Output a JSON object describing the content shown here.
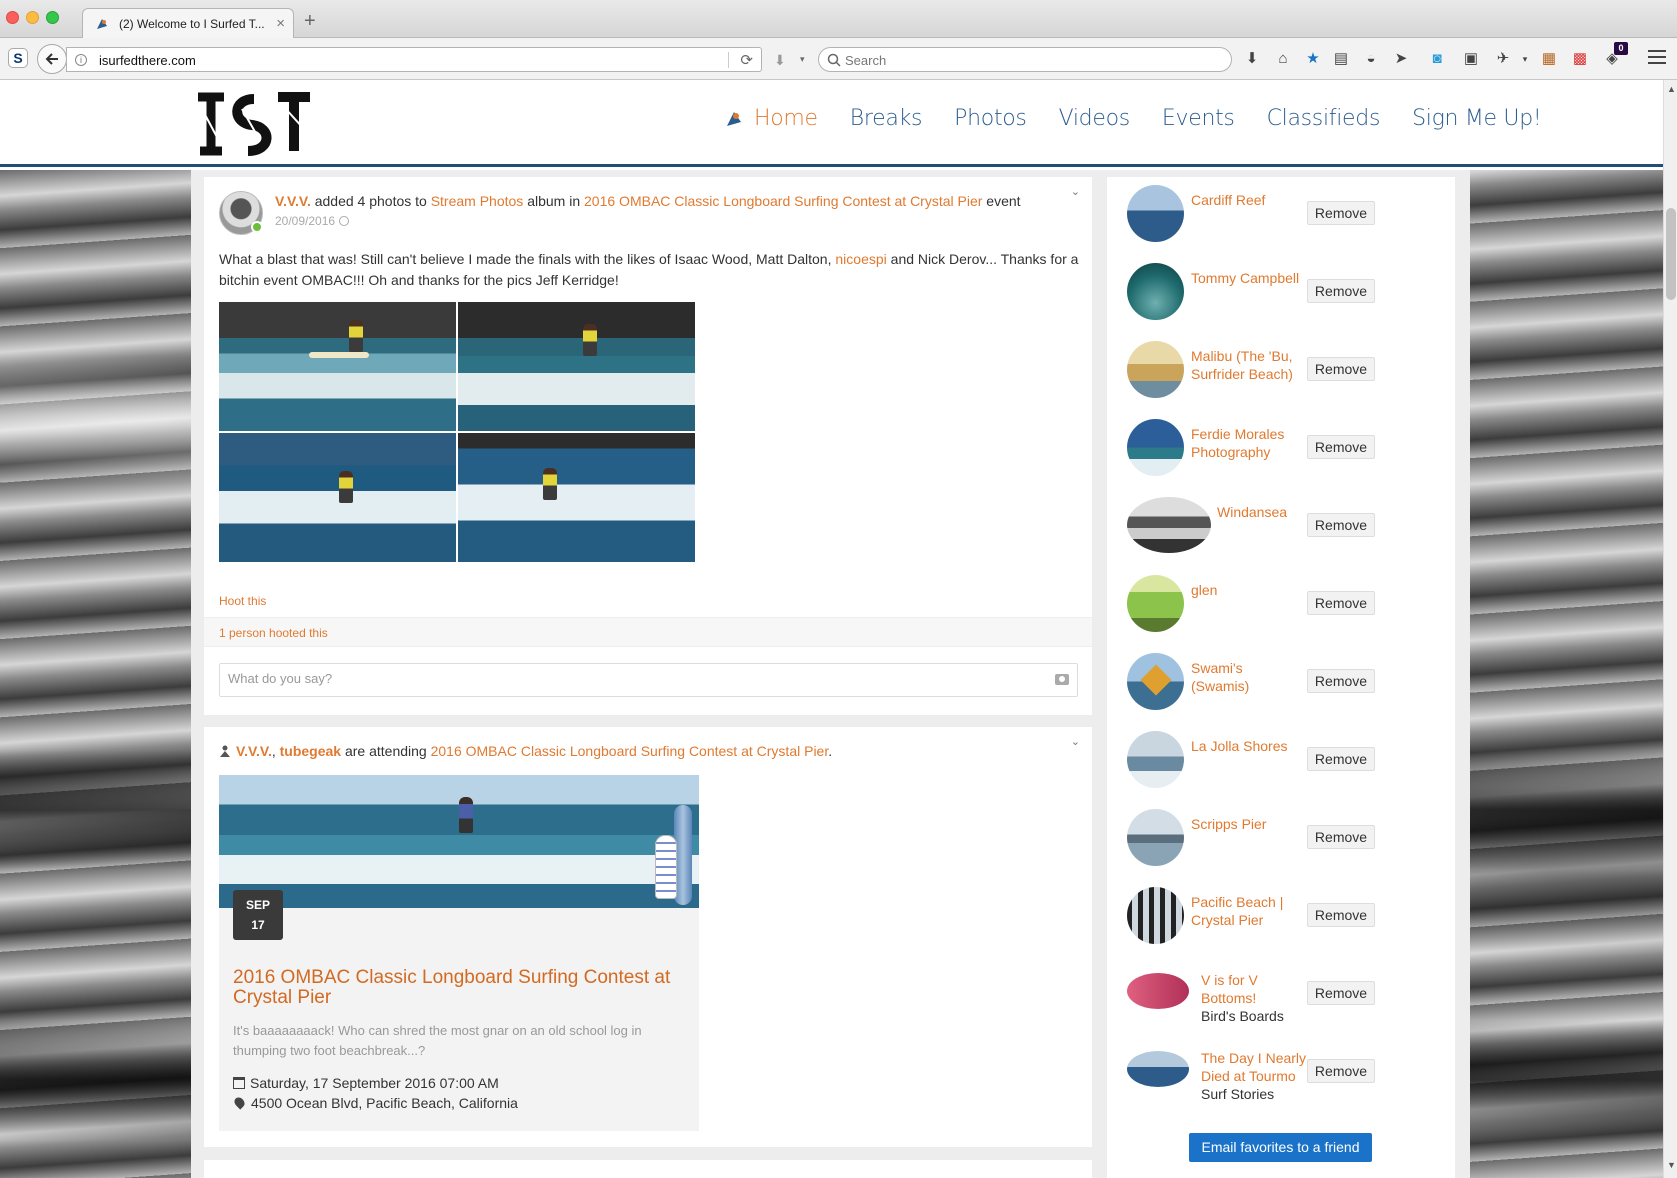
{
  "browser": {
    "tab_title": "(2) Welcome to I Surfed T...",
    "url": "isurfedthere.com",
    "search_placeholder": "Search",
    "new_tab": "+",
    "tab_close": "×",
    "reload": "⟳",
    "download": "⬇",
    "dropdown": "▾",
    "notification_count": "0",
    "icons": [
      "download-icon",
      "home-icon",
      "bookmark-star-icon",
      "reading-list-icon",
      "pocket-icon",
      "send-icon",
      "skype-icon",
      "youtube-icon",
      "bird-icon",
      "dropdown-icon",
      "notes-icon",
      "flag-icon",
      "extension-icon"
    ]
  },
  "site": {
    "logo_text": "ISТ",
    "nav": [
      {
        "label": "Home",
        "active": true
      },
      {
        "label": "Breaks",
        "active": false
      },
      {
        "label": "Photos",
        "active": false
      },
      {
        "label": "Videos",
        "active": false
      },
      {
        "label": "Events",
        "active": false
      },
      {
        "label": "Classifieds",
        "active": false
      },
      {
        "label": "Sign Me Up!",
        "active": false
      }
    ]
  },
  "feed": {
    "post1": {
      "author": "V.V.V.",
      "action": " added 4 photos to ",
      "album": "Stream Photos",
      "album_suffix": " album in ",
      "event": "2016 OMBAC Classic Longboard Surfing Contest at Crystal Pier",
      "event_suffix": " event",
      "date": "20/09/2016",
      "body_before": "What a blast that was! Still can't believe I made the finals with the likes of Isaac Wood, Matt Dalton, ",
      "body_mention": "nicoespi",
      "body_after": " and Nick Derov... Thanks for a bitchin event OMBAC!!! Oh and thanks for the pics Jeff Kerridge!",
      "hoot_label": "Hoot this",
      "hoot_count": "1 person hooted this",
      "comment_placeholder": "What do you say?"
    },
    "post2": {
      "user1": "V.V.V.",
      "separator": ", ",
      "user2": "tubegeak",
      "action": " are attending ",
      "event": "2016 OMBAC Classic Longboard Surfing Contest at Crystal Pier",
      "period": ".",
      "date_month": "SEP",
      "date_day": "17",
      "event_title": "2016 OMBAC Classic Longboard Surfing Contest at Crystal Pier",
      "event_desc": "It's baaaaaaaack! Who can shred the most gnar on an old school log in thumping two foot beachbreak...?",
      "event_when": "Saturday, 17 September 2016 07:00 AM",
      "event_where": "4500 Ocean Blvd, Pacific Beach, California"
    }
  },
  "sidebar": {
    "remove_label": "Remove",
    "email_button": "Email favorites to a friend",
    "favorites": [
      {
        "name": "Cardiff Reef",
        "sub": ""
      },
      {
        "name": "Tommy Campbell",
        "sub": ""
      },
      {
        "name": "Malibu (The 'Bu, Surfrider Beach)",
        "sub": ""
      },
      {
        "name": "Ferdie Morales Photography",
        "sub": ""
      },
      {
        "name": "Windansea",
        "sub": ""
      },
      {
        "name": "glen",
        "sub": ""
      },
      {
        "name": "Swami's (Swamis)",
        "sub": ""
      },
      {
        "name": "La Jolla Shores",
        "sub": ""
      },
      {
        "name": "Scripps Pier",
        "sub": ""
      },
      {
        "name": "Pacific Beach | Crystal Pier",
        "sub": ""
      },
      {
        "name": "V is for V Bottoms!",
        "sub": "Bird's Boards"
      },
      {
        "name": "The Day I Nearly Died at Tourmo",
        "sub": "Surf Stories"
      }
    ]
  },
  "colors": {
    "accent": "#e07a30",
    "nav_blue": "#2c5d8f",
    "header_border": "#1f4e79",
    "button_blue": "#1a73c8"
  }
}
